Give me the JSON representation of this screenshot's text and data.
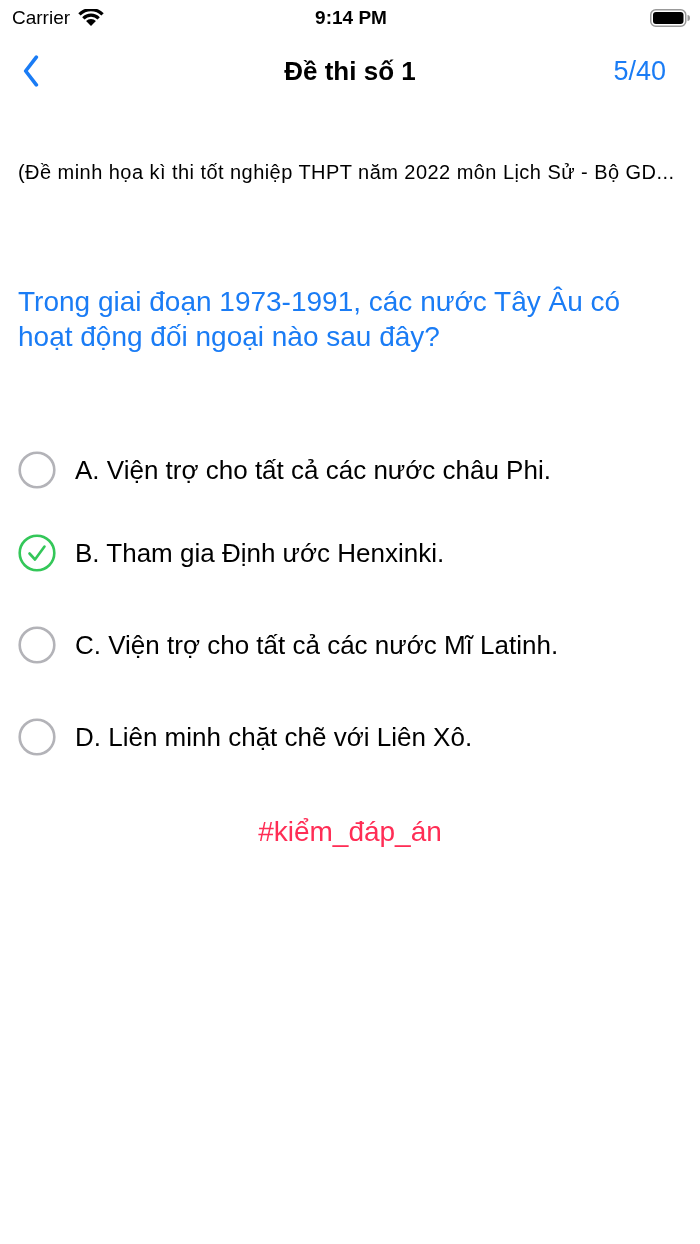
{
  "status_bar": {
    "carrier": "Carrier",
    "time": "9:14 PM"
  },
  "nav_bar": {
    "title": "Đề thi số 1",
    "counter": "5/40"
  },
  "exam_subtitle": "(Đề minh họa kì thi tốt nghiệp THPT năm 2022 môn Lịch Sử - Bộ GD...",
  "question": "Trong giai đoạn 1973-1991, các nước Tây Âu có hoạt động đối ngoại nào sau đây?",
  "options": [
    {
      "label": "A. Viện trợ cho tất cả các nước châu Phi.",
      "selected": false
    },
    {
      "label": "B. Tham gia Định ước Henxinki.",
      "selected": true
    },
    {
      "label": "C. Viện trợ cho tất cả các nước Mĩ Latinh.",
      "selected": false
    },
    {
      "label": "D. Liên minh chặt chẽ với Liên Xô.",
      "selected": false
    }
  ],
  "hashtag": "#kiểm_đáp_án"
}
